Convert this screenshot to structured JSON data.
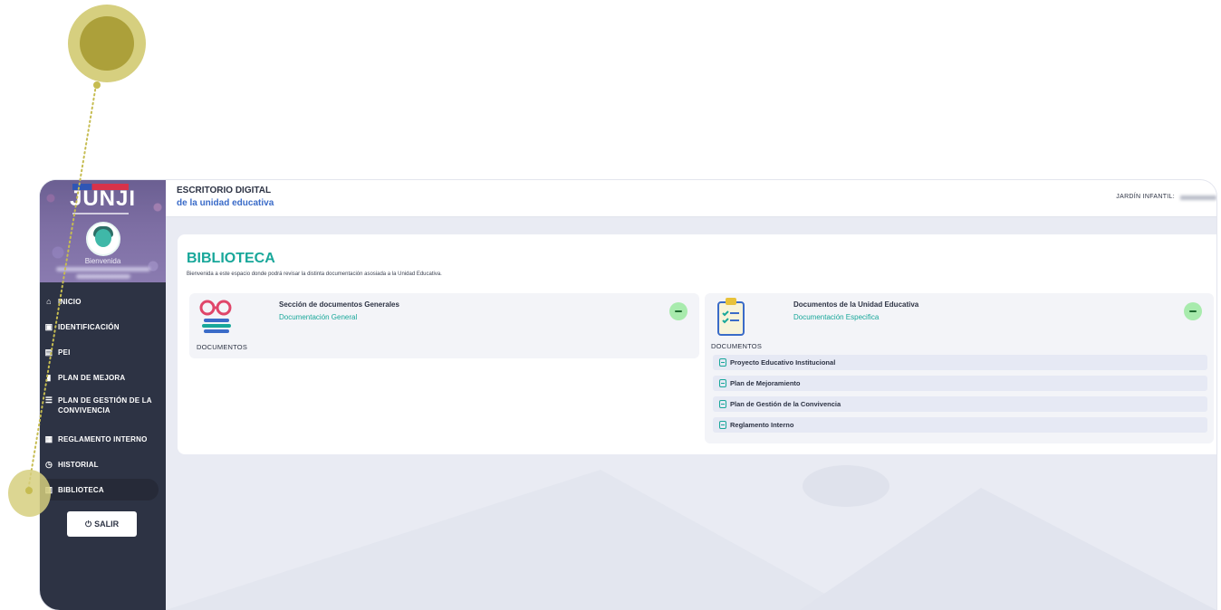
{
  "sidebar": {
    "logo": "JUNJI",
    "welcome": "Bienvenida",
    "menu": [
      {
        "label": "INICIO",
        "icon": "home-icon"
      },
      {
        "label": "IDENTIFICACIÓN",
        "icon": "id-card-icon"
      },
      {
        "label": "PEI",
        "icon": "folder-icon"
      },
      {
        "label": "PLAN DE MEJORA",
        "icon": "clipboard-icon"
      },
      {
        "label": "PLAN DE GESTIÓN DE LA CONVIVENCIA",
        "icon": "list-icon"
      },
      {
        "label": "REGLAMENTO INTERNO",
        "icon": "document-icon"
      },
      {
        "label": "HISTORIAL",
        "icon": "clock-icon"
      },
      {
        "label": "BIBLIOTECA",
        "icon": "books-icon"
      }
    ],
    "logout_label": "SALIR"
  },
  "topbar": {
    "title": "ESCRITORIO DIGITAL",
    "subtitle": "de la unidad educativa",
    "right_label": "JARDÍN INFANTIL:"
  },
  "library": {
    "title": "BIBLIOTECA",
    "description": "Bienvenida a este espacio donde podrá revisar la distinta documentación asosiada a la Unidad Educativa.",
    "left_panel": {
      "name": "Sección de documentos Generales",
      "link": "Documentación General",
      "caption": "DOCUMENTOS"
    },
    "right_panel": {
      "name": "Documentos de la Unidad Educativa",
      "link": "Documentación Especifica",
      "caption": "DOCUMENTOS",
      "documents": [
        "Proyecto Educativo Institucional",
        "Plan de Mejoramiento",
        "Plan de Gestión de la Convivencia",
        "Reglamento Interno"
      ]
    }
  },
  "colors": {
    "accent": "#18a79a",
    "sidebar": "#2d3344",
    "link_blue": "#3a6bc8",
    "tutorial_marker": "#aca03a"
  }
}
